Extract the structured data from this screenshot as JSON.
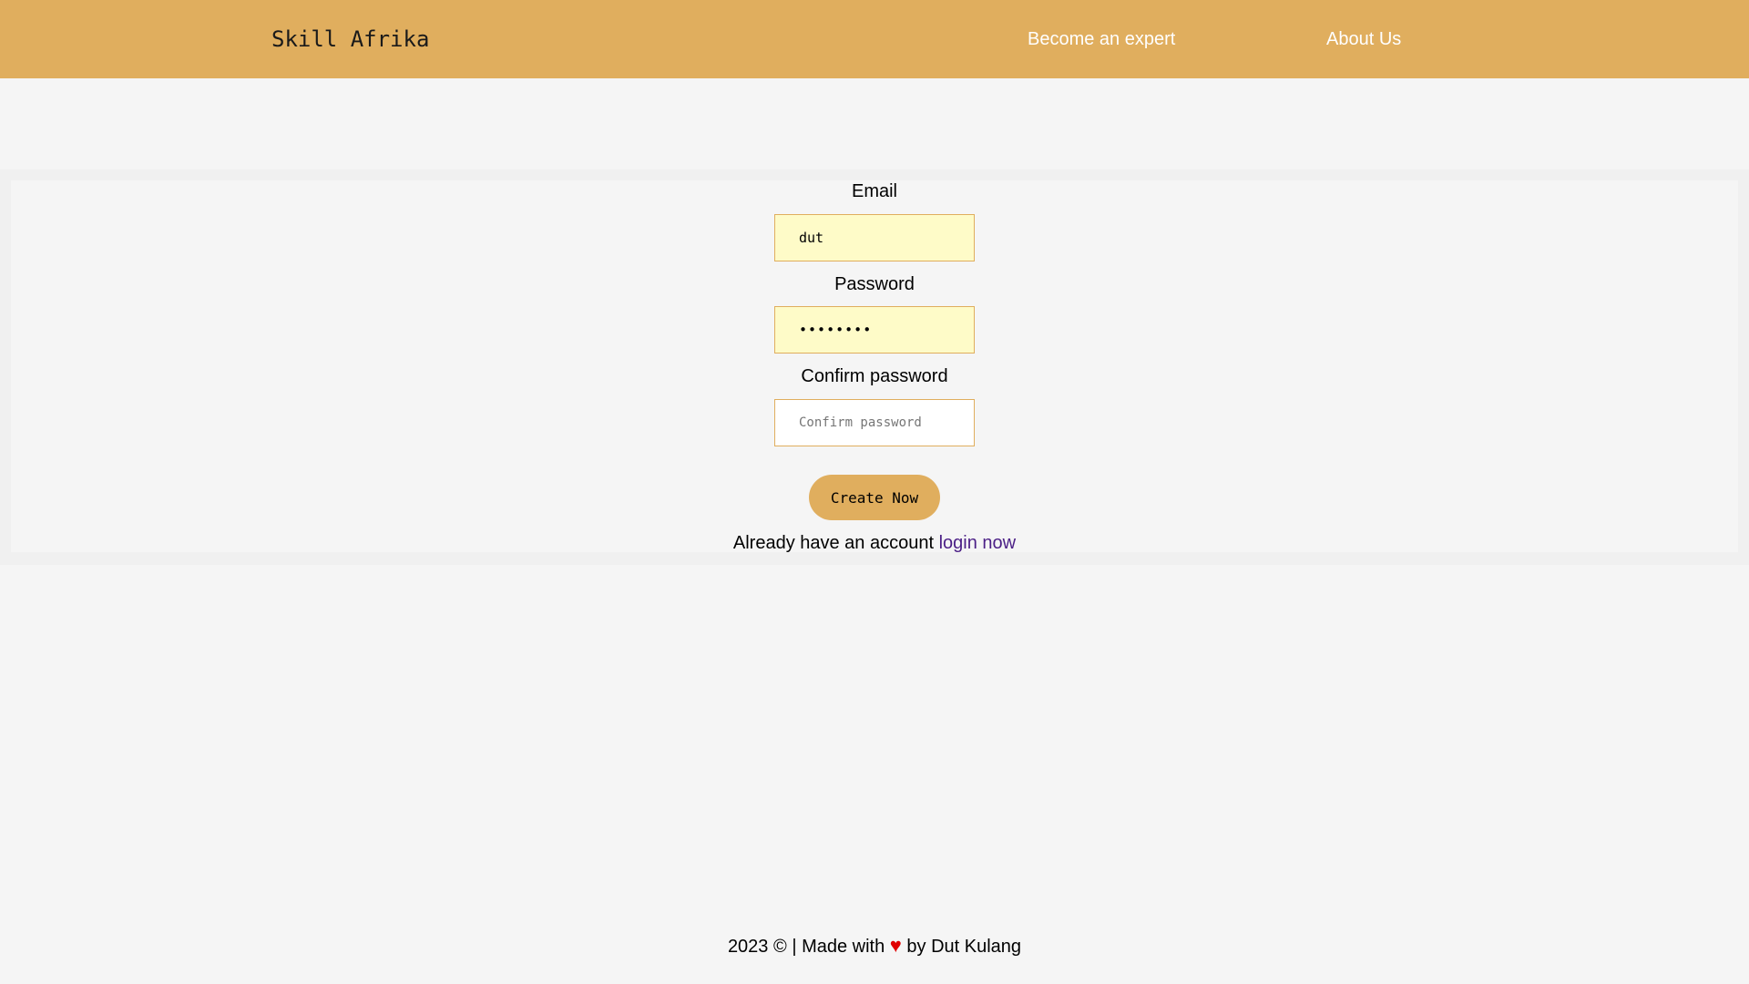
{
  "navbar": {
    "brand": "Skill Afrika",
    "links": [
      {
        "label": "Become an expert"
      },
      {
        "label": "About Us"
      }
    ],
    "color": "#e0ae5e"
  },
  "form": {
    "email_label": "Email",
    "email_value": "dut",
    "password_label": "Password",
    "password_value": "password",
    "confirm_label": "Confirm password",
    "confirm_placeholder": "Confirm password",
    "submit_label": "Create Now",
    "account_text": "Already have an account",
    "login_link": "login now"
  },
  "footer": {
    "year": "2023",
    "copyright_symbol": "©",
    "made_with": "| Made with",
    "heart": "♥",
    "by": "by Dut Kulang"
  },
  "colors": {
    "accent": "#e0ae5e",
    "autofill_bg": "#fefbc8",
    "link": "#4b1f86",
    "heart": "#e00000"
  }
}
